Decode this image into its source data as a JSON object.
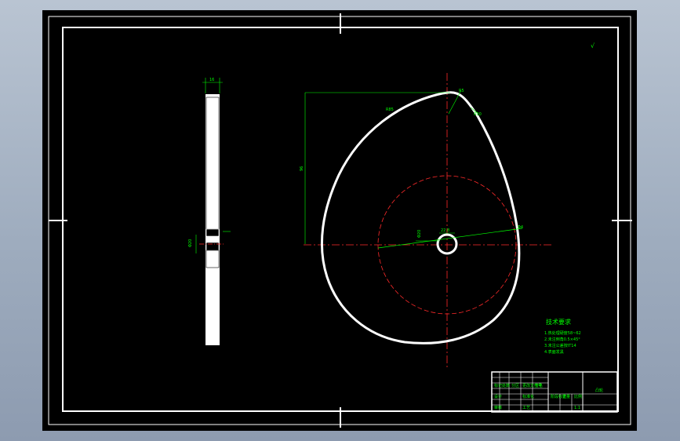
{
  "drawing": {
    "surface_mark": "√",
    "notes": {
      "title": "技术要求",
      "lines": [
        "1.热处理硬度58~62",
        "2.未注倒角0.5×45°",
        "3.未注公差按IT14",
        "4.表面发黑"
      ]
    },
    "title_block": {
      "part_name": "凸轮",
      "scale": "1:1",
      "cells": [
        "标记",
        "处数",
        "分区",
        "更改文件号",
        "签名",
        "年月日",
        "设计",
        "标准化",
        "阶段标记",
        "重量",
        "比例",
        "审核",
        "工艺",
        "批准"
      ]
    },
    "dims": {
      "left_thickness": "16",
      "left_hub": "Φ20",
      "radius_top": "R5",
      "radius_left": "R85",
      "vertical": "96",
      "bore": "Φ20",
      "keyway": "22.8",
      "radius_right": "R10",
      "angle": "Φ4"
    }
  },
  "colors": {
    "background": "#000000",
    "outline": "#ffffff",
    "dimension": "#00ff00",
    "centerline": "#ff2a2a"
  }
}
